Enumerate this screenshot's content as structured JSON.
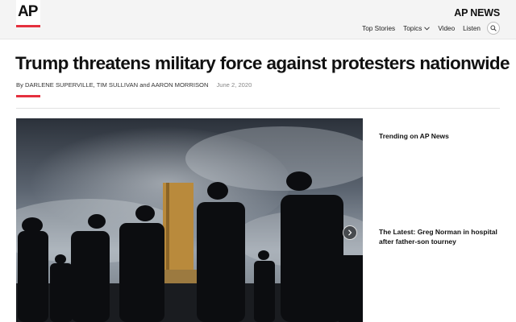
{
  "header": {
    "logo_text": "AP",
    "brand": "AP NEWS",
    "nav": [
      "Top Stories",
      "Topics",
      "Video",
      "Listen"
    ],
    "colors": {
      "accent": "#e5303e",
      "topbar": "#f4f4f4"
    },
    "icons": {
      "topics_dropdown": "chevron-down-icon",
      "search": "search-icon"
    }
  },
  "article": {
    "headline": "Trump threatens military force against protesters nationwide",
    "byline": "By DARLENE SUPERVILLE, TIM SULLIVAN and AARON MORRISON",
    "date": "June 2, 2020",
    "carousel_icon": "chevron-right-icon"
  },
  "sidebar": {
    "heading": "Trending on AP News",
    "story": "The Latest: Greg Norman in hospital after father-son tourney"
  }
}
